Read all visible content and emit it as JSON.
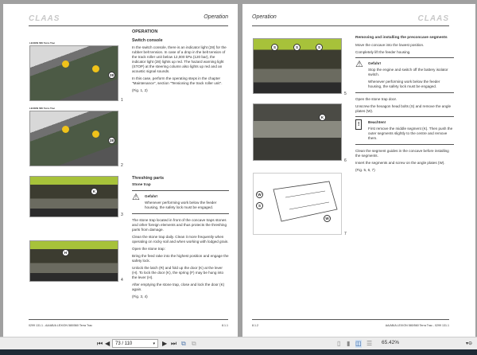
{
  "viewer": {
    "page_field": "73 / 110",
    "zoom": "65.42%",
    "icons": [
      "first-page-icon",
      "prev-page-icon",
      "next-page-icon",
      "last-page-icon",
      "copy-page-icon",
      "paste-page-icon",
      "single-page-view-icon",
      "continuous-view-icon",
      "two-page-view-icon",
      "continuous-two-page-icon"
    ]
  },
  "left_page": {
    "logo": "CLAAS",
    "header": "Operation",
    "section": "OPERATION",
    "switch_console": {
      "title": "Switch console",
      "p1": "In the switch console, there is an indicator light (28) for the rubber belt tension. In case of a drop in the belt tension of the track roller unit below 12,000 kPa (120 bar), the indicator light (28) lights up red. The hazard warning light (STOP) at the steering column also lights up red and an acoustic signal sounds.",
      "p2": "In this case, perform the operating steps in the chapter \"Maintenance\", section \"Tensioning the track roller unit\".",
      "p3": "(Fig. 1, 2)"
    },
    "threshing": {
      "title": "Threshing parts",
      "sub": "Stone trap",
      "warn_title": "Gefahr!",
      "warn_text": "Whenever performing work below the feeder housing, the safety lock must be engaged.",
      "p1": "The stone trap located in front of the concave traps stones and other foreign elements and thus protects the threshing parts from damage.",
      "p2": "Clean the stone trap daily. Clean it more frequently when operating on rocky soil and when working with lodged grain.",
      "p3": "Open the stone trap:",
      "p4": "Bring the feed rake into the highest position and engage the safety lock.",
      "p5": "Unlock the latch (R) and fold up the door (K) at the lever (H). To lock the door (K), the spring (F) may be hung into the lever (H).",
      "p6": "After emptying the stone trap, close and lock the door (K) again.",
      "p7": "(Fig. 3, 4)"
    },
    "figures": [
      {
        "caption": "LEXION 580 Terra Trac",
        "num": "1",
        "label": "28"
      },
      {
        "caption": "LEXION 580 Terra Trac",
        "num": "2",
        "label": "28"
      },
      {
        "num": "3",
        "label": "K"
      },
      {
        "num": "4",
        "label": "H"
      }
    ],
    "footer_left": "0299 131.1 - AA/AB/A LEXION 580/560 Terra Trac",
    "footer_right": "8.1.1"
  },
  "right_page": {
    "logo": "CLAAS",
    "header": "Operation",
    "title": "Removing and installing the preconcave segments",
    "p1": "Move the concave into the lowest position.",
    "p2": "Completely lift the feeder housing.",
    "warn_title": "Gefahr!",
    "warn_text1": "Stop the engine and switch off the battery isolator switch.",
    "warn_text2": "Whenever performing work below the feeder housing, the safety lock must be engaged.",
    "p3": "Open the stone trap door.",
    "p4": "Unscrew the hexagon head bolts (S) and remove the angle plates (W).",
    "note_title": "Beachten!",
    "note_text": "First remove the middle segment (K). Then push the outer segments slightly to the centre and remove them.",
    "p5": "Clean the segment guides in the concave before installing the segments.",
    "p6": "Insert the segments and screw on the angle plates (W).",
    "p7": "(Fig. 5, 6, 7)",
    "figures": [
      {
        "num": "5",
        "labels": [
          "S",
          "S",
          "S"
        ]
      },
      {
        "num": "6",
        "label": "K"
      },
      {
        "num": "7",
        "labels": [
          "W",
          "S",
          "W"
        ]
      }
    ],
    "footer_left": "8.1.2",
    "footer_right": "AA/AB/A LEXION 580/560 Terra Trac - 0299 131.1"
  }
}
